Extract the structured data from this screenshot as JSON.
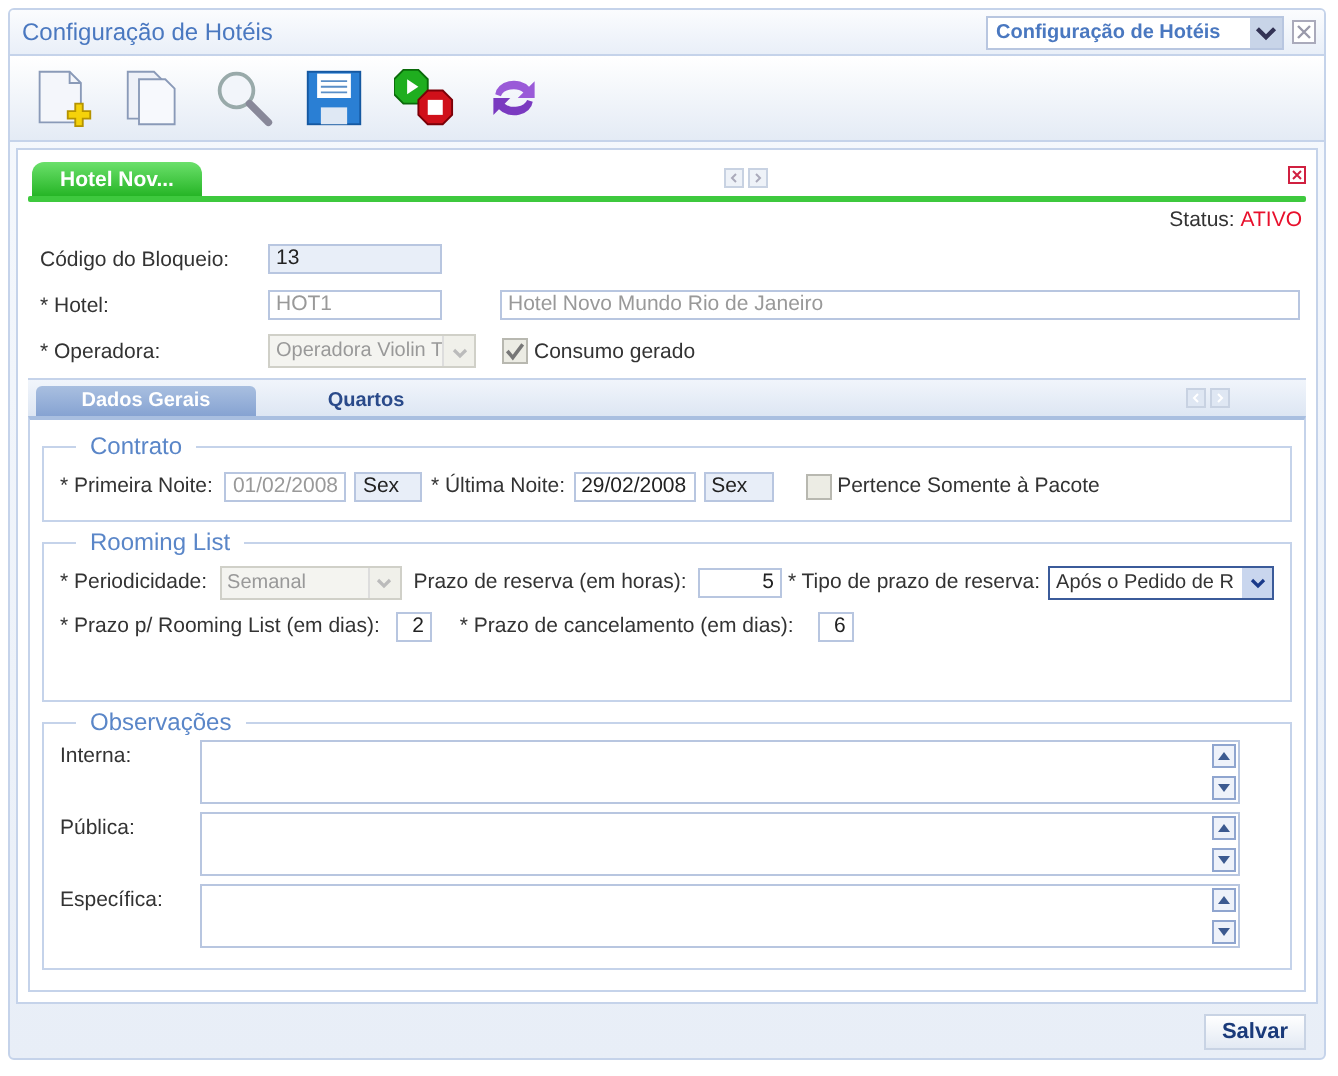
{
  "window": {
    "title": "Configuração de Hotéis",
    "selector": "Configuração de Hotéis"
  },
  "toolbar": [
    {
      "kind": "new"
    },
    {
      "kind": "copy"
    },
    {
      "kind": "search"
    },
    {
      "kind": "save"
    },
    {
      "kind": "start-stop"
    },
    {
      "kind": "refresh"
    }
  ],
  "doc_tabs": [
    {
      "label": "Hotel Nov...",
      "selected": true
    }
  ],
  "status": {
    "label": "Status:",
    "value": "ATIVO"
  },
  "header": {
    "codigo": {
      "label": "Código do Bloqueio:",
      "value": "13",
      "readonly": true
    },
    "hotel": {
      "label": "* Hotel:",
      "code": {
        "value": "HOT1",
        "disabled": true
      },
      "name": {
        "value": "Hotel Novo Mundo Rio de Janeiro",
        "disabled": true
      }
    },
    "operadora": {
      "label": "* Operadora:",
      "value": "Operadora Violin T",
      "disabled": true
    },
    "consumo": {
      "label": "Consumo gerado",
      "checked": true,
      "disabled": true
    }
  },
  "section_tabs": [
    {
      "label": "Dados Gerais",
      "selected": true
    },
    {
      "label": "Quartos",
      "selected": false
    }
  ],
  "contrato": {
    "legend": "Contrato",
    "primeira": {
      "label": "* Primeira Noite:",
      "value": "01/02/2008",
      "disabled": true,
      "day": "Sex"
    },
    "ultima": {
      "label": "* Última Noite:",
      "value": "29/02/2008",
      "day": "Sex"
    },
    "pacote": {
      "label": "Pertence Somente à Pacote",
      "checked": false,
      "disabled": true
    }
  },
  "rooming": {
    "legend": "Rooming List",
    "periodicidade": {
      "label": "* Periodicidade:",
      "value": "Semanal",
      "disabled": true
    },
    "prazo_reserva": {
      "label": "Prazo de reserva (em horas):",
      "value": "5"
    },
    "tipo_prazo": {
      "label": "* Tipo de prazo de reserva:",
      "value": "Após o Pedido de R"
    },
    "prazo_rooming": {
      "label": "* Prazo p/ Rooming List (em dias):",
      "value": "2"
    },
    "prazo_cancelamento": {
      "label": "* Prazo de cancelamento (em dias):",
      "value": "6"
    }
  },
  "observacoes": {
    "legend": "Observações",
    "fields": [
      {
        "label": "Interna:"
      },
      {
        "label": "Pública:"
      },
      {
        "label": "Específica:"
      }
    ]
  },
  "save_button": "Salvar"
}
